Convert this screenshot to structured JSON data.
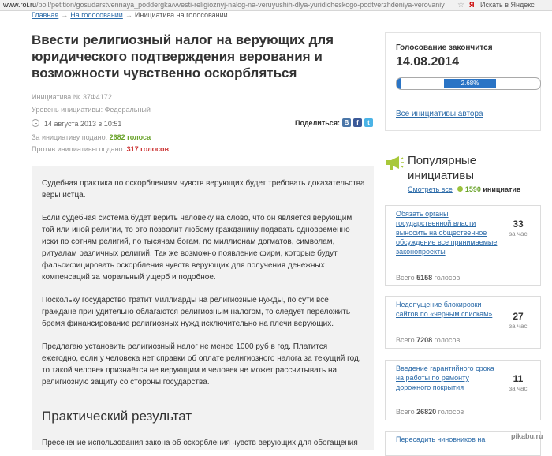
{
  "browser": {
    "url_domain": "www.roi.ru",
    "url_path": "/poll/petition/gosudarstvennaya_poddergka/vvesti-religioznyj-nalog-na-veruyushih-dlya-yuridicheskogo-podtverzhdeniya-verovaniya-i-vozmo",
    "yandex_logo": "Я",
    "search_placeholder": "Искать в Яндекс"
  },
  "breadcrumb": {
    "home": "Главная",
    "sep1": "→",
    "voting": "На голосовании",
    "sep2": "→",
    "current": "Инициатива на голосовании"
  },
  "petition": {
    "title": "Ввести религиозный налог на верующих для юридического подтверждения верования и возможности чувственно оскорбляться",
    "number": "Инициатива № 37Ф4172",
    "level": "Уровень инициативы: Федеральный",
    "date": "14 августа 2013 в 10:51",
    "for_label": "За инициативу подано:",
    "for_value": "2682 голоса",
    "against_label": "Против инициативы подано:",
    "against_value": "317 голосов",
    "share_label": "Поделиться:"
  },
  "body": {
    "p1": "Судебная практика по оскорблениям чувств верующих будет требовать доказательства веры истца.",
    "p2": "Если судебная система будет верить человеку на слово, что он является верующим той или иной религии, то это позволит любому гражданину подавать одновременно иски по сотням религий, по тысячам богам, по миллионам догматов, символам, ритуалам различных религий. Так же возможно появление фирм, которые будут фальсифицировать оскорбления чувств верующих для получения денежных компенсаций за моральный ущерб и подобное.",
    "p3": "Поскольку государство тратит миллиарды на религиозные нужды, по сути все граждане принудительно облагаются религиозным налогом, то следует переложить бремя финансирование религиозных нужд исключительно на плечи верующих.",
    "p4": "Предлагаю установить религиозный налог не менее 1000 руб в год. Платится ежегодно, если у человека нет справки об оплате религиозного налога за текущий год, то такой человек признаётся не верующим и человек не может рассчитывать на религиозную защиту со стороны государства.",
    "result_heading": "Практический результат",
    "p5": "Пресечение использования закона об оскорбления чувств верующих для обогащения"
  },
  "voting": {
    "ends_label": "Голосование закончится",
    "ends_date": "14.08.2014",
    "progress_text": "2.68%",
    "progress_fraction": 0.0268,
    "author_link": "Все инициативы автора"
  },
  "popular": {
    "title": "Популярные инициативы",
    "see_all": "Смотреть все",
    "count": "1590",
    "count_word": "инициатив",
    "items": [
      {
        "title": "Обязать органы государственной власти выносить на общественное обсуждение все принимаемые законопроекты",
        "per_hour": "33",
        "per_hour_label": "за час",
        "total_label": "Всего",
        "total": "5158",
        "total_unit": "голосов"
      },
      {
        "title": "Недопущение блокировки сайтов по «черным спискам»",
        "per_hour": "27",
        "per_hour_label": "за час",
        "total_label": "Всего",
        "total": "7208",
        "total_unit": "голосов"
      },
      {
        "title": "Введение гарантийного срока на работы по ремонту дорожного покрытия",
        "per_hour": "11",
        "per_hour_label": "за час",
        "total_label": "Всего",
        "total": "26820",
        "total_unit": "голосов"
      },
      {
        "title": "Пересадить чиновников на"
      }
    ]
  },
  "watermark": "pikabu.ru",
  "colors": {
    "link": "#2a6aa8",
    "progress": "#2a74c5",
    "for_votes": "#6aa32b",
    "against_votes": "#cc3333",
    "megaphone": "#a8c83a"
  }
}
